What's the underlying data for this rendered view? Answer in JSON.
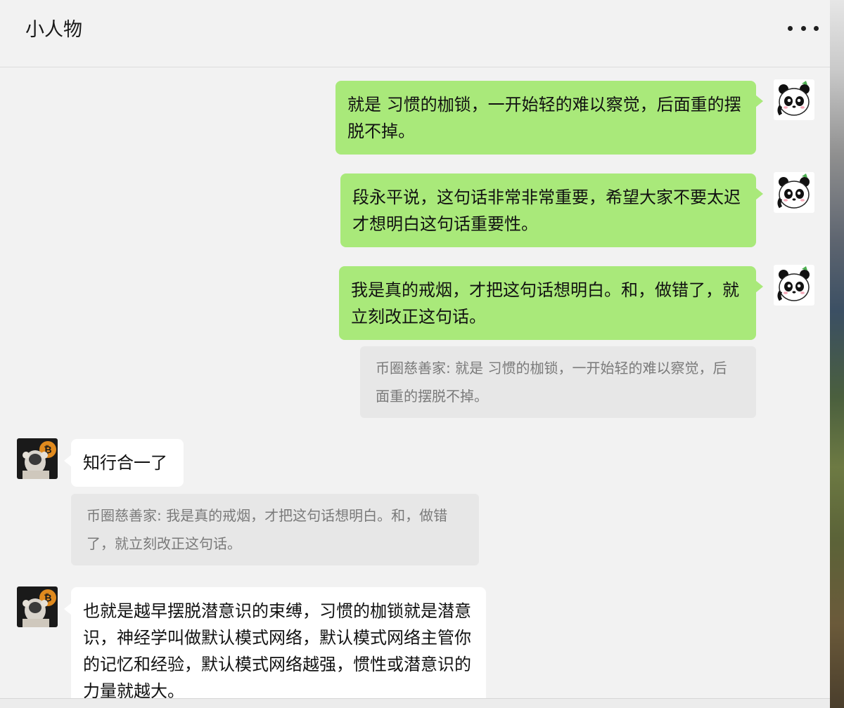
{
  "chat": {
    "title": "小人物"
  },
  "messages": [
    {
      "sender": "me",
      "text": "就是 习惯的枷锁，一开始轻的难以察觉，后面重的摆脱不掉。"
    },
    {
      "sender": "me",
      "text": "段永平说，这句话非常非常重要，希望大家不要太迟才想明白这句话重要性。"
    },
    {
      "sender": "me",
      "text": "我是真的戒烟，才把这句话想明白。和，做错了，就立刻改正这句话。",
      "quote": "币圈慈善家: 就是 习惯的枷锁，一开始轻的难以察觉，后面重的摆脱不掉。"
    },
    {
      "sender": "other",
      "text": "知行合一了",
      "quote": "币圈慈善家: 我是真的戒烟，才把这句话想明白。和，做错了，就立刻改正这句话。"
    },
    {
      "sender": "other",
      "text": "也就是越早摆脱潜意识的束缚，习惯的枷锁就是潜意识，神经学叫做默认模式网络，默认模式网络主管你的记忆和经验，默认模式网络越强，惯性或潜意识的力量就越大。"
    }
  ],
  "icons": {
    "more": "more-dots-icon",
    "my_avatar": "panda-avatar",
    "other_avatar": "astronaut-bitcoin-avatar"
  },
  "colors": {
    "my_bubble": "#a9e97a",
    "other_bubble": "#ffffff",
    "quote_bg": "#e7e7e7",
    "background": "#f2f2f2"
  }
}
